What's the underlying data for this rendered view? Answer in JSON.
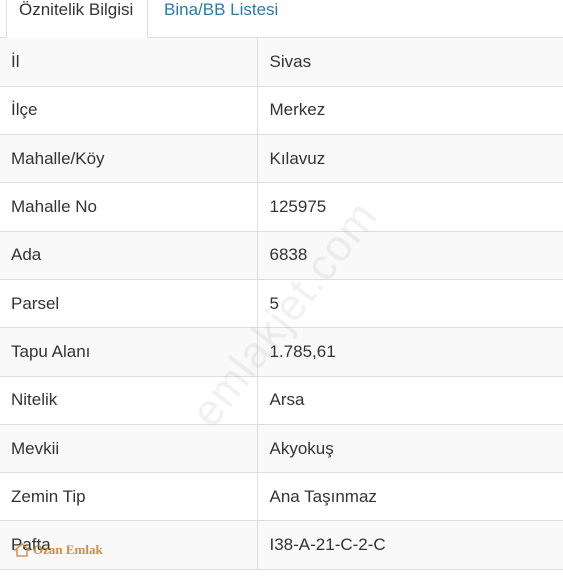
{
  "tabs": [
    {
      "label": "Öznitelik Bilgisi",
      "active": true
    },
    {
      "label": "Bina/BB Listesi",
      "active": false
    }
  ],
  "rows": [
    {
      "key": "İl",
      "value": "Sivas"
    },
    {
      "key": "İlçe",
      "value": "Merkez"
    },
    {
      "key": "Mahalle/Köy",
      "value": "Kılavuz"
    },
    {
      "key": "Mahalle No",
      "value": "125975"
    },
    {
      "key": "Ada",
      "value": "6838"
    },
    {
      "key": "Parsel",
      "value": "5"
    },
    {
      "key": "Tapu Alanı",
      "value": "1.785,61"
    },
    {
      "key": "Nitelik",
      "value": "Arsa"
    },
    {
      "key": "Mevkii",
      "value": "Akyokuş"
    },
    {
      "key": "Zemin Tip",
      "value": "Ana Taşınmaz"
    },
    {
      "key": "Pafta",
      "value": "I38-A-21-C-2-C"
    }
  ],
  "watermark": "emlakjet.com",
  "logo": {
    "text": "Ozan Emlak",
    "color": "#c87828"
  },
  "colors": {
    "link": "#2a7ab0",
    "border": "#dddddd",
    "stripe": "#f9f9f9"
  }
}
